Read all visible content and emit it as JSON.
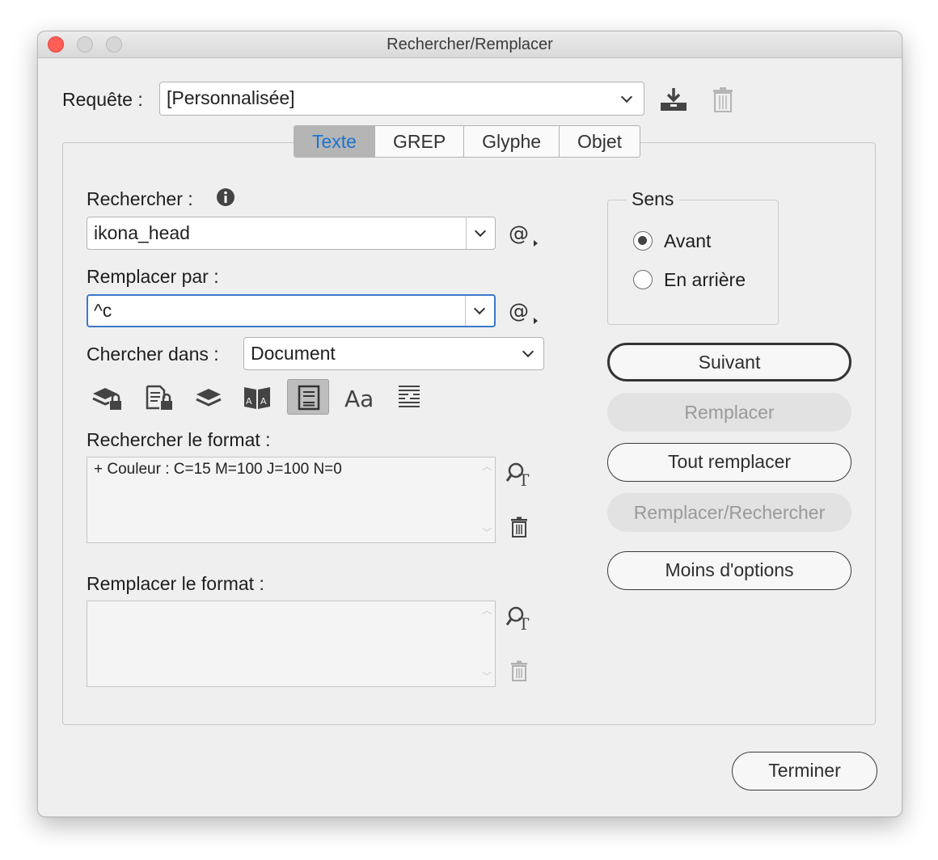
{
  "window": {
    "title": "Rechercher/Remplacer"
  },
  "query": {
    "label": "Requête :",
    "value": "[Personnalisée]"
  },
  "tabs": [
    {
      "label": "Texte",
      "active": true
    },
    {
      "label": "GREP",
      "active": false
    },
    {
      "label": "Glyphe",
      "active": false
    },
    {
      "label": "Objet",
      "active": false
    }
  ],
  "search": {
    "label": "Rechercher :",
    "value": "ikona_head"
  },
  "replace": {
    "label": "Remplacer par :",
    "value": "^c"
  },
  "scope": {
    "label": "Chercher dans :",
    "value": "Document"
  },
  "option_icons": [
    "locked-layers-icon",
    "locked-stories-icon",
    "hidden-layers-icon",
    "master-pages-icon",
    "footnotes-icon",
    "case-sensitive-icon",
    "whole-word-icon"
  ],
  "find_format": {
    "label": "Rechercher le format :",
    "value": "+ Couleur : C=15 M=100 J=100 N=0"
  },
  "change_format": {
    "label": "Remplacer le format :",
    "value": ""
  },
  "direction": {
    "title": "Sens",
    "options": [
      {
        "label": "Avant",
        "selected": true
      },
      {
        "label": "En arrière",
        "selected": false
      }
    ]
  },
  "buttons": {
    "next": "Suivant",
    "replace": "Remplacer",
    "replace_all": "Tout remplacer",
    "replace_find": "Remplacer/Rechercher",
    "fewer_options": "Moins d'options",
    "done": "Terminer"
  },
  "colors": {
    "accent": "#1b73d0",
    "focus": "#3b79c9",
    "close": "#ff5f57"
  }
}
